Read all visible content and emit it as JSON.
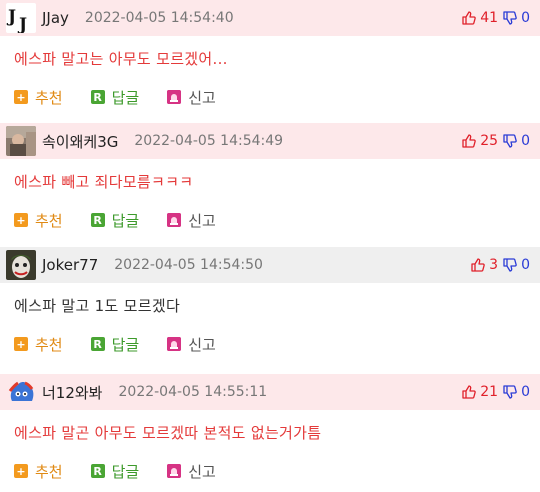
{
  "comments": [
    {
      "nickname": "JJay",
      "date": "2022-04-05 14:54:40",
      "up": "41",
      "down": "0",
      "text": "에스파 말고는 아무도 모르겠어...",
      "avatar": "jj-logo-avatar"
    },
    {
      "nickname": "속이왜케3G",
      "date": "2022-04-05 14:54:49",
      "up": "25",
      "down": "0",
      "text": "에스파 빼고 죄다모름ㅋㅋㅋ",
      "avatar": "photo-avatar"
    },
    {
      "nickname": "Joker77",
      "date": "2022-04-05 14:54:50",
      "up": "3",
      "down": "0",
      "text": "에스파 말고 1도 모르겠다",
      "avatar": "joker-avatar"
    },
    {
      "nickname": "너12와봐",
      "date": "2022-04-05 14:55:11",
      "up": "21",
      "down": "0",
      "text": "에스파 말곤 아무도 모르겠따 본적도 없는거가틈",
      "avatar": "cartoon-avatar"
    }
  ],
  "actions": {
    "recommend": "추천",
    "reply": "답글",
    "report": "신고"
  },
  "icons": {
    "thumbs_up": "thumbs-up-icon",
    "thumbs_down": "thumbs-down-icon",
    "recommend": "plus-icon",
    "reply": "reply-icon",
    "report": "siren-icon"
  },
  "colors": {
    "header_pink": "#fde8ea",
    "header_gray": "#efefef",
    "up_red": "#e0202a",
    "down_blue": "#2a3bd6",
    "body_red": "#e43a3a",
    "recommend_orange": "#f39a1e",
    "reply_green": "#4aa534"
  }
}
